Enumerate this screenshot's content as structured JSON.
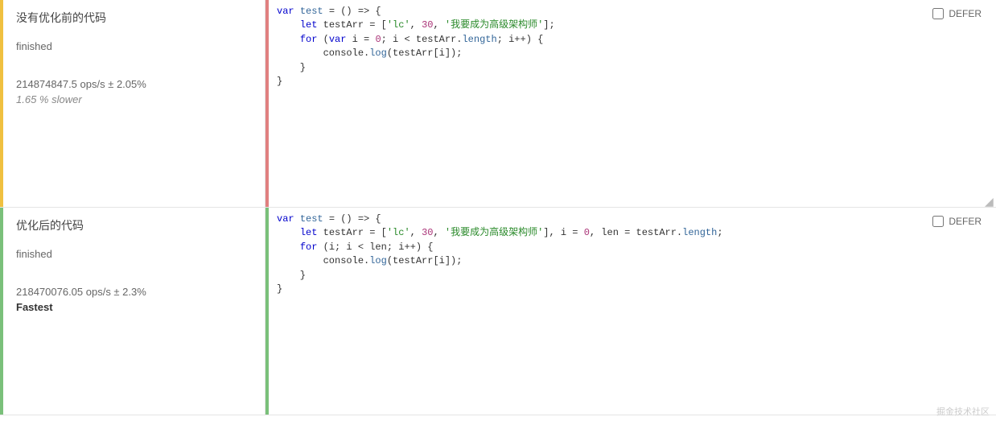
{
  "tests": [
    {
      "title": "没有优化前的代码",
      "status": "finished",
      "ops": "214874847.5 ops/s ± 2.05%",
      "note": "1.65 % slower",
      "note_bold": false,
      "left_indicator": "indicator-yellow",
      "code_indicator": "code-red",
      "defer_label": "DEFER",
      "defer_checked": false,
      "code_tokens": [
        {
          "t": "kw",
          "v": "var"
        },
        {
          "t": "pl",
          "v": " "
        },
        {
          "t": "fn",
          "v": "test"
        },
        {
          "t": "pl",
          "v": " = () => {\n    "
        },
        {
          "t": "kw",
          "v": "let"
        },
        {
          "t": "pl",
          "v": " testArr = ["
        },
        {
          "t": "str",
          "v": "'lc'"
        },
        {
          "t": "pl",
          "v": ", "
        },
        {
          "t": "num",
          "v": "30"
        },
        {
          "t": "pl",
          "v": ", "
        },
        {
          "t": "str",
          "v": "'我要成为高级架构师'"
        },
        {
          "t": "pl",
          "v": "];\n    "
        },
        {
          "t": "kw",
          "v": "for"
        },
        {
          "t": "pl",
          "v": " ("
        },
        {
          "t": "kw",
          "v": "var"
        },
        {
          "t": "pl",
          "v": " i = "
        },
        {
          "t": "num",
          "v": "0"
        },
        {
          "t": "pl",
          "v": "; i < testArr."
        },
        {
          "t": "fn",
          "v": "length"
        },
        {
          "t": "pl",
          "v": "; i++) {\n        console."
        },
        {
          "t": "fn",
          "v": "log"
        },
        {
          "t": "pl",
          "v": "(testArr[i]);\n    }\n}"
        }
      ]
    },
    {
      "title": "优化后的代码",
      "status": "finished",
      "ops": "218470076.05 ops/s ± 2.3%",
      "note": "Fastest",
      "note_bold": true,
      "left_indicator": "indicator-green",
      "code_indicator": "code-green",
      "defer_label": "DEFER",
      "defer_checked": false,
      "code_tokens": [
        {
          "t": "kw",
          "v": "var"
        },
        {
          "t": "pl",
          "v": " "
        },
        {
          "t": "fn",
          "v": "test"
        },
        {
          "t": "pl",
          "v": " = () => {\n    "
        },
        {
          "t": "kw",
          "v": "let"
        },
        {
          "t": "pl",
          "v": " testArr = ["
        },
        {
          "t": "str",
          "v": "'lc'"
        },
        {
          "t": "pl",
          "v": ", "
        },
        {
          "t": "num",
          "v": "30"
        },
        {
          "t": "pl",
          "v": ", "
        },
        {
          "t": "str",
          "v": "'我要成为高级架构师'"
        },
        {
          "t": "pl",
          "v": "], i = "
        },
        {
          "t": "num",
          "v": "0"
        },
        {
          "t": "pl",
          "v": ", len = testArr."
        },
        {
          "t": "fn",
          "v": "length"
        },
        {
          "t": "pl",
          "v": ";\n    "
        },
        {
          "t": "kw",
          "v": "for"
        },
        {
          "t": "pl",
          "v": " (i; i < len; i++) {\n        console."
        },
        {
          "t": "fn",
          "v": "log"
        },
        {
          "t": "pl",
          "v": "(testArr[i]);\n    }\n}"
        }
      ]
    }
  ],
  "watermark": "掘金技术社区"
}
